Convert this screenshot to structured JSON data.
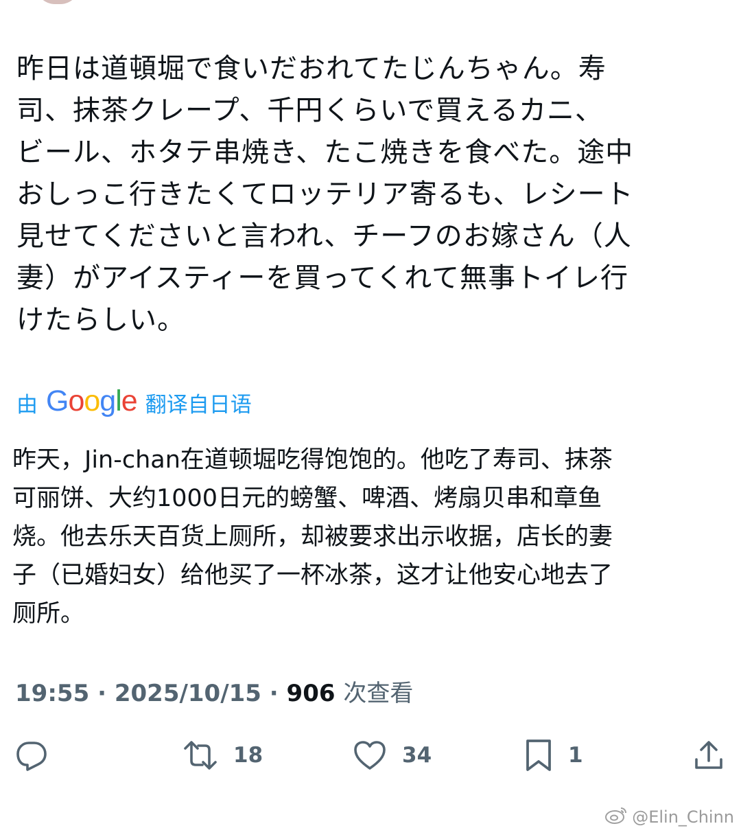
{
  "tweet": {
    "original_text": "昨日は道頓堀で食いだおれてたじんちゃん。寿\n司、抹茶クレープ、千円くらいで買えるカニ、\nビール、ホタテ串焼き、たこ焼きを食べた。途中\nおしっこ行きたくてロッテリア寄るも、レシート\n見せてくださいと言われ、チーフのお嫁さん（人\n妻）がアイスティーを買ってくれて無事トイレ行\nけたらしい。",
    "translation": {
      "prefix": "由",
      "provider": "Google",
      "suffix": "翻译自日语"
    },
    "translated_text": "昨天，Jin-chan在道顿堀吃得饱饱的。他吃了寿司、抹茶\n可丽饼、大约1000日元的螃蟹、啤酒、烤扇贝串和章鱼\n烧。他去乐天百货上厕所，却被要求出示收据，店长的妻\n子（已婚妇女）给他买了一杯冰茶，这才让他安心地去了\n厕所。",
    "meta": {
      "time": "19:55",
      "separator": "·",
      "date": "2025/10/15",
      "views_count": "906",
      "views_label": "次查看"
    },
    "actions": {
      "reply": {
        "icon": "reply-icon",
        "count": ""
      },
      "retweet": {
        "icon": "retweet-icon",
        "count": "18"
      },
      "like": {
        "icon": "heart-icon",
        "count": "34"
      },
      "bookmark": {
        "icon": "bookmark-icon",
        "count": "1"
      },
      "share": {
        "icon": "share-icon",
        "count": ""
      }
    }
  },
  "watermark": {
    "icon": "weibo-icon",
    "text": "@Elin_Chinn"
  },
  "colors": {
    "text_primary": "#0f1419",
    "text_secondary": "#536471",
    "link_blue": "#1d9bf0",
    "google_blue": "#4285f4",
    "google_red": "#ea4335",
    "google_yellow": "#fbbc05",
    "google_green": "#34a853",
    "background": "#ffffff"
  }
}
